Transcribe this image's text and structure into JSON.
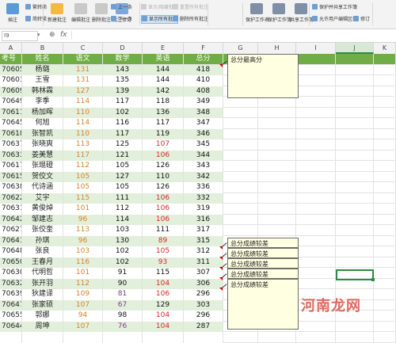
{
  "ribbon": {
    "big": [
      {
        "label": "插注",
        "color": "#5b9bd5"
      },
      {
        "label": "新建批注",
        "color": "#f4b942"
      },
      {
        "label": "编辑批注",
        "color": "#c9c9c9"
      },
      {
        "label": "删除批注",
        "color": "#c9c9c9"
      },
      {
        "label": "批注修订",
        "color": "#7ca7d8"
      },
      {
        "label": "保护工作表",
        "color": "#7f8fa6"
      },
      {
        "label": "保护工作簿",
        "color": "#7f8fa6"
      },
      {
        "label": "共享工作簿",
        "color": "#7f8fa6"
      }
    ],
    "small": [
      {
        "label": "繁转简",
        "state": "normal"
      },
      {
        "label": "简转繁",
        "state": "normal"
      },
      {
        "label": "上一条",
        "state": "normal"
      },
      {
        "label": "下一条",
        "state": "normal"
      },
      {
        "label": "显示/隐藏批注",
        "state": "dim"
      },
      {
        "label": "显示所有批注",
        "state": "hl"
      },
      {
        "label": "重置所有批注",
        "state": "dim"
      },
      {
        "label": "删除所有批注",
        "state": "normal"
      },
      {
        "label": "保护并共享工作簿",
        "state": "normal"
      },
      {
        "label": "允许用户编辑区域",
        "state": "normal"
      },
      {
        "label": "修订",
        "state": "normal"
      }
    ]
  },
  "formula_bar": {
    "name_box": "I9",
    "fx": "fx",
    "value": ""
  },
  "columns": [
    "A",
    "B",
    "C",
    "D",
    "E",
    "F",
    "G",
    "H",
    "I",
    "J",
    "K"
  ],
  "selected_column": "J",
  "table": {
    "headers": [
      "考号",
      "姓名",
      "语文",
      "数学",
      "英语",
      "总分"
    ],
    "rows": [
      [
        "70605",
        "杨璐",
        "131",
        "143",
        "144",
        "418"
      ],
      [
        "70603",
        "王雪",
        "131",
        "135",
        "144",
        "410"
      ],
      [
        "70609",
        "韩林霖",
        "127",
        "139",
        "142",
        "408"
      ],
      [
        "70649",
        "李季",
        "114",
        "117",
        "118",
        "349"
      ],
      [
        "70611",
        "杨加晖",
        "110",
        "102",
        "136",
        "348"
      ],
      [
        "70645",
        "何旭",
        "114",
        "116",
        "117",
        "347"
      ],
      [
        "70618",
        "张智凯",
        "110",
        "117",
        "119",
        "346"
      ],
      [
        "70637",
        "张晓爽",
        "113",
        "125",
        "107",
        "345"
      ],
      [
        "70633",
        "姜美慧",
        "117",
        "121",
        "106",
        "344"
      ],
      [
        "70617",
        "张琨磴",
        "112",
        "105",
        "126",
        "343"
      ],
      [
        "70615",
        "贺佼文",
        "105",
        "127",
        "110",
        "342"
      ],
      [
        "70638",
        "代诗涵",
        "105",
        "105",
        "126",
        "336"
      ],
      [
        "70622",
        "艾宇",
        "115",
        "111",
        "106",
        "332"
      ],
      [
        "70631",
        "黄俊焯",
        "101",
        "112",
        "106",
        "319"
      ],
      [
        "70642",
        "邹建志",
        "96",
        "114",
        "106",
        "316"
      ],
      [
        "70627",
        "张佼奎",
        "113",
        "103",
        "111",
        "317"
      ],
      [
        "70641",
        "孙琪",
        "96",
        "130",
        "89",
        "315"
      ],
      [
        "70648",
        "张良",
        "103",
        "102",
        "105",
        "312"
      ],
      [
        "70650",
        "王春月",
        "116",
        "102",
        "93",
        "311"
      ],
      [
        "70630",
        "代明哲",
        "101",
        "91",
        "115",
        "307"
      ],
      [
        "70632",
        "张开羽",
        "112",
        "90",
        "104",
        "306"
      ],
      [
        "70639",
        "狄建译",
        "109",
        "81",
        "106",
        "296"
      ],
      [
        "70647",
        "张家硕",
        "107",
        "67",
        "129",
        "303"
      ],
      [
        "70655",
        "郭娜",
        "94",
        "98",
        "104",
        "296"
      ],
      [
        "70644",
        "周坤",
        "107",
        "76",
        "104",
        "287"
      ]
    ]
  },
  "colors": {
    "header_bg": "#70ad47",
    "row_band": "#e2efda",
    "chinese_orange": "#d9822b",
    "math_black": "#111111",
    "english_red": "#d02b2b",
    "comment_bg": "#ffffe1"
  },
  "comments": {
    "top": "总分最高分",
    "bottom": [
      "总分成绩较差",
      "总分成绩较差",
      "总分成绩较差",
      "总分成绩较差",
      "总分成绩较差"
    ]
  },
  "watermark": {
    "title": "河南龙网",
    "url": ""
  }
}
